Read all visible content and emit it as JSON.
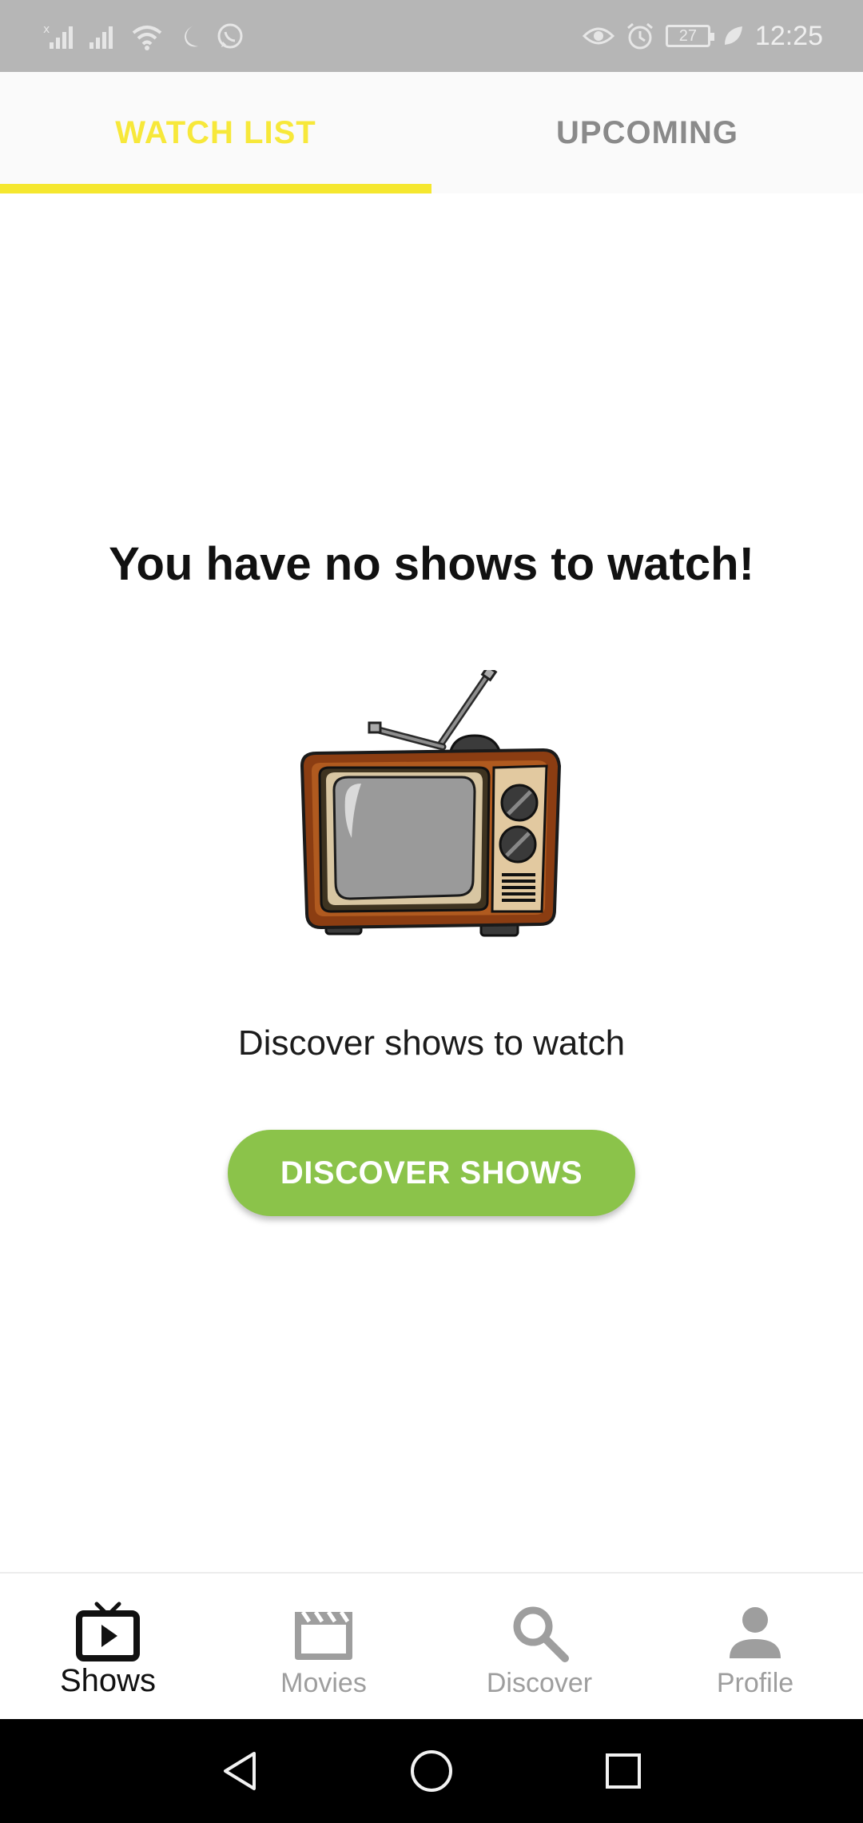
{
  "status_bar": {
    "time": "12:25",
    "battery": "27",
    "left_icons": [
      "no-sim-signal-icon",
      "signal-icon",
      "wifi-icon",
      "moon-icon",
      "whatsapp-icon"
    ],
    "right_icons": [
      "eye-icon",
      "alarm-icon",
      "battery-icon",
      "leaf-icon"
    ]
  },
  "tabs": [
    {
      "label": "WATCH LIST",
      "active": true
    },
    {
      "label": "UPCOMING",
      "active": false
    }
  ],
  "empty_state": {
    "title": "You have no shows to watch!",
    "illustration": "retro-tv-icon",
    "subtitle": "Discover shows to watch",
    "button_label": "DISCOVER SHOWS"
  },
  "bottom_nav": [
    {
      "label": "Shows",
      "icon": "tv-play-icon",
      "active": true
    },
    {
      "label": "Movies",
      "icon": "clapperboard-icon",
      "active": false
    },
    {
      "label": "Discover",
      "icon": "search-icon",
      "active": false
    },
    {
      "label": "Profile",
      "icon": "person-icon",
      "active": false
    }
  ],
  "system_nav": [
    "back-icon",
    "home-icon",
    "recents-icon"
  ],
  "colors": {
    "accent_yellow": "#f5e72f",
    "button_green": "#8bc34a",
    "status_bar": "#b6b6b6"
  }
}
